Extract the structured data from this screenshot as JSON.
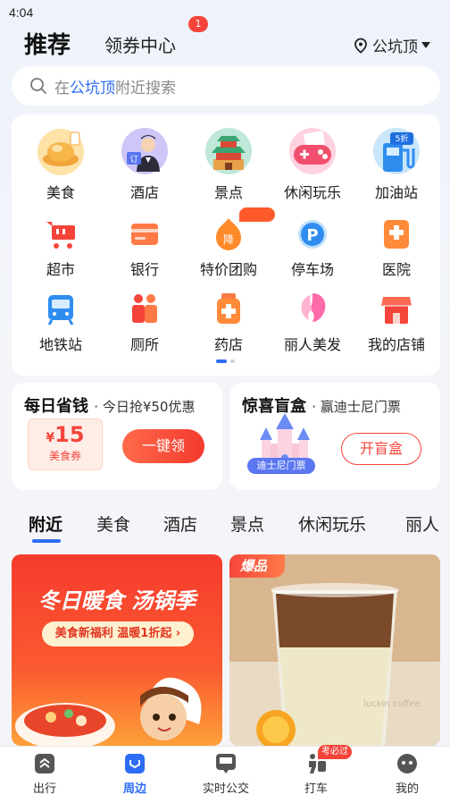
{
  "status_bar": {
    "time": "4:04"
  },
  "header": {
    "title": "推荐",
    "coupon_center": "领券中心",
    "coupon_badge": "1",
    "location": "公坑顶"
  },
  "search": {
    "prefix": "在",
    "highlight": "公坑顶",
    "suffix": "附近搜索"
  },
  "categories": [
    {
      "label": "美食",
      "icon": "food-icon"
    },
    {
      "label": "酒店",
      "icon": "hotel-icon"
    },
    {
      "label": "景点",
      "icon": "attraction-icon"
    },
    {
      "label": "休闲玩乐",
      "icon": "game-icon"
    },
    {
      "label": "加油站",
      "icon": "gas-station-icon"
    },
    {
      "label": "超市",
      "icon": "cart-icon"
    },
    {
      "label": "银行",
      "icon": "bank-card-icon"
    },
    {
      "label": "特价团购",
      "icon": "discount-icon",
      "icon_text": "降"
    },
    {
      "label": "停车场",
      "icon": "parking-icon",
      "icon_text": "P"
    },
    {
      "label": "医院",
      "icon": "hospital-icon"
    },
    {
      "label": "地铁站",
      "icon": "subway-icon"
    },
    {
      "label": "厕所",
      "icon": "toilet-icon"
    },
    {
      "label": "药店",
      "icon": "pharmacy-icon"
    },
    {
      "label": "丽人美发",
      "icon": "beauty-icon"
    },
    {
      "label": "我的店铺",
      "icon": "shop-icon"
    }
  ],
  "gas_icon_text": "5折",
  "hotel_icon_text": "订",
  "promo_daily": {
    "title": "每日省钱",
    "subtitle": "· 今日抢¥50优惠",
    "coupon_currency": "¥",
    "coupon_amount": "15",
    "coupon_type": "美食券",
    "button": "一键领"
  },
  "promo_box": {
    "title": "惊喜盲盒",
    "subtitle": "· 赢迪士尼门票",
    "tag": "迪士尼门票",
    "button": "开盲盒"
  },
  "feed_tabs": [
    "附近",
    "美食",
    "酒店",
    "景点",
    "休闲玩乐",
    "丽人"
  ],
  "feed": {
    "card1_headline": "冬日暖食 汤锅季",
    "card1_pill": "美食新福利 温暖1折起 ›",
    "card2_hot": "爆品",
    "card2_cup_text": "luckin coffee"
  },
  "bottom_nav": [
    {
      "label": "出行",
      "icon": "travel-icon"
    },
    {
      "label": "周边",
      "icon": "nearby-icon"
    },
    {
      "label": "实时公交",
      "icon": "bus-icon"
    },
    {
      "label": "打车",
      "icon": "taxi-icon"
    },
    {
      "label": "我的",
      "icon": "profile-icon"
    }
  ],
  "taxi_tag": "考必过",
  "colors": {
    "accent": "#2d6cf5",
    "red": "#f5453b"
  }
}
